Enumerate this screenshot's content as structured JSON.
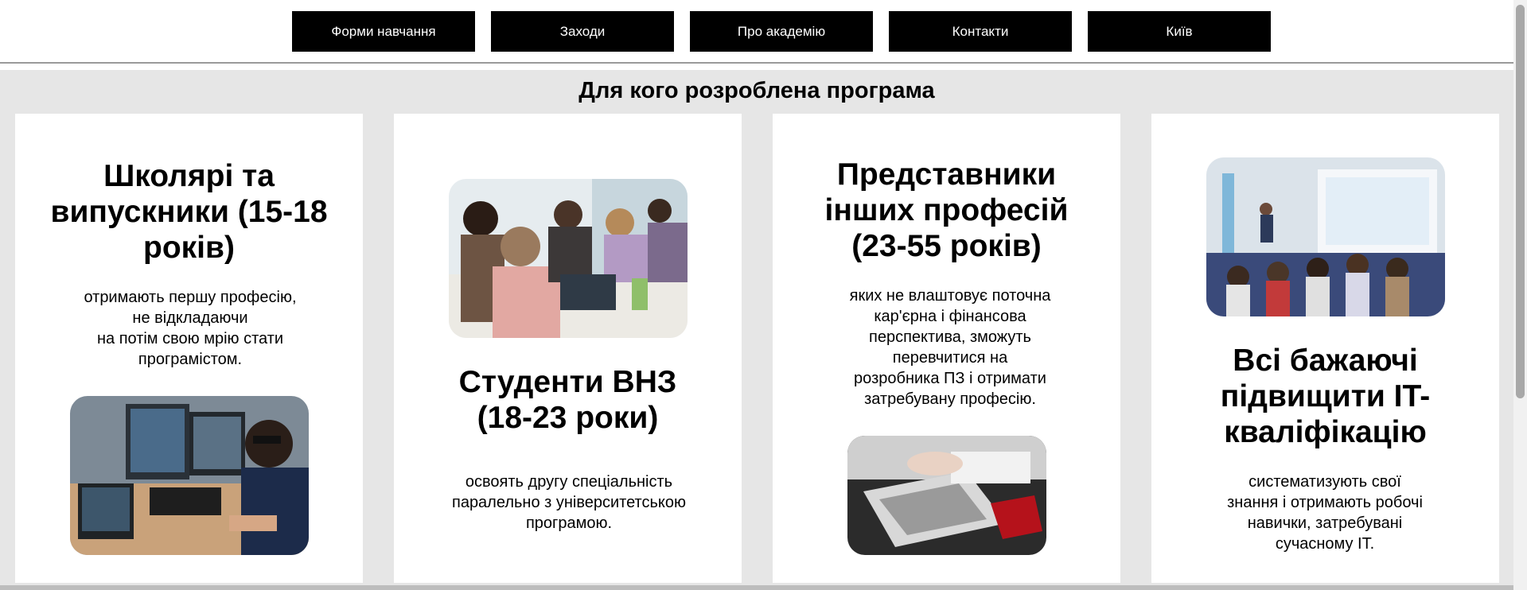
{
  "nav": {
    "items": [
      {
        "label": "Форми навчання"
      },
      {
        "label": "Заходи"
      },
      {
        "label": "Про академію"
      },
      {
        "label": "Контакти"
      },
      {
        "label": "Київ"
      }
    ]
  },
  "section": {
    "title": "Для кого розроблена програма",
    "cards": [
      {
        "title": "Школярі та\nвипускники (15-18\nроків)",
        "text": "отримають першу професію,\nне відкладаючи\nна потім свою мрію стати\nпрограмістом.",
        "image": "student-at-computers-photo"
      },
      {
        "title": "Студенти ВНЗ\n(18-23 роки)",
        "text": "освоять другу спеціальність\nпаралельно з університетською\nпрограмою.",
        "image": "group-study-photo"
      },
      {
        "title": "Представники\nінших професій\n(23-55 років)",
        "text": "яких не влаштовує поточна\nкар'єрна і фінансова\nперспектива, зможуть\nперевчитися на\nрозробника ПЗ і отримати\nзатребувану професію.",
        "image": "laptop-notebook-photo"
      },
      {
        "title": "Всі бажаючі\nпідвищити IT-\nкваліфікацію",
        "text": "систематизують свої\nзнання і отримають робочі\nнавички, затребувані\nсучасному IT.",
        "image": "lecture-hall-photo"
      }
    ]
  },
  "colors": {
    "nav_bg": "#000000",
    "nav_text": "#ffffff",
    "section_bg": "#e6e6e6",
    "card_bg": "#ffffff"
  }
}
